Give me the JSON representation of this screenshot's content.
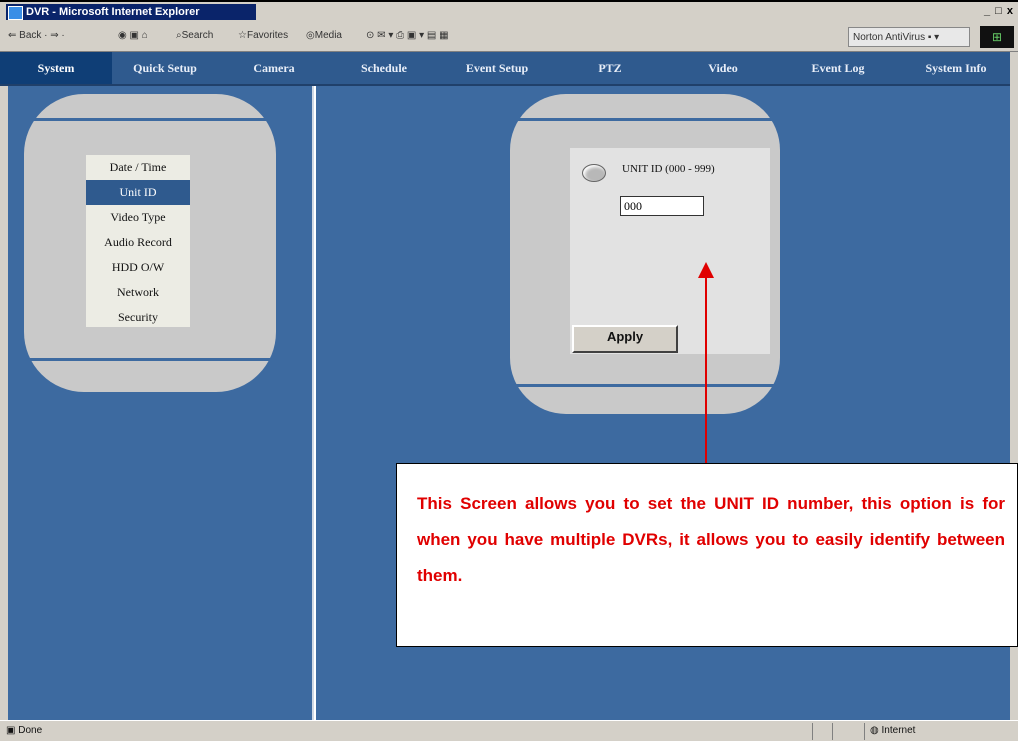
{
  "window": {
    "title": "DVR - Microsoft Internet Explorer",
    "controls": "_ □ x"
  },
  "toolbar": {
    "nav_buttons": "⇐ Back · ⇒ ·",
    "search": "Search",
    "favorites": "Favorites",
    "media": "Media",
    "norton": "Norton AntiVirus ▪ ▾"
  },
  "nav": {
    "tabs": [
      "System",
      "Quick Setup",
      "Camera",
      "Schedule",
      "Event Setup",
      "PTZ",
      "Video",
      "Event Log",
      "System Info"
    ],
    "active": "System"
  },
  "menu": {
    "items": [
      "Date / Time",
      "Unit ID",
      "Video Type",
      "Audio Record",
      "HDD O/W",
      "Network",
      "Security"
    ],
    "selected": "Unit ID"
  },
  "form": {
    "label": "UNIT ID (000 - 999)",
    "value": "000",
    "apply_label": "Apply"
  },
  "callout": {
    "text": "This Screen allows you to set the UNIT ID number, this option is for when you have multiple DVRs, it allows you to easily identify between them."
  },
  "status": {
    "left": "Done",
    "zone": "Internet"
  },
  "colors": {
    "accent": "#3d6aa0",
    "annotation": "#e00000",
    "panel": "#c9c9c9"
  }
}
